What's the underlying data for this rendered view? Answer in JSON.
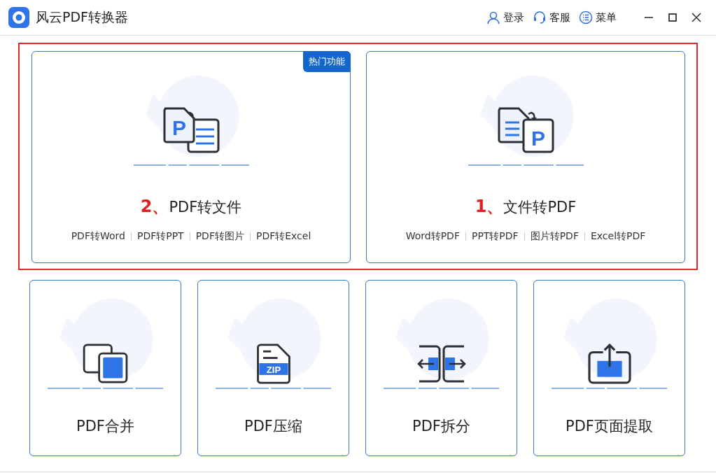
{
  "window": {
    "title": "风云PDF转换器"
  },
  "header_actions": [
    {
      "kind": "user",
      "label": "登录"
    },
    {
      "kind": "headset",
      "label": "客服"
    },
    {
      "kind": "menu",
      "label": "菜单"
    }
  ],
  "features": [
    {
      "kind": "pdf-to-file",
      "number": "2、",
      "title": "PDF转文件",
      "badge": "热门功能",
      "icon_letter": "P",
      "links": [
        "PDF转Word",
        "PDF转PPT",
        "PDF转图片",
        "PDF转Excel"
      ]
    },
    {
      "kind": "file-to-pdf",
      "number": "1、",
      "title": "文件转PDF",
      "icon_letter": "P",
      "links": [
        "Word转PDF",
        "PPT转PDF",
        "图片转PDF",
        "Excel转PDF"
      ]
    }
  ],
  "tools": [
    {
      "kind": "merge",
      "title": "PDF合并"
    },
    {
      "kind": "zip",
      "title": "PDF压缩",
      "icon_label": "ZIP"
    },
    {
      "kind": "split",
      "title": "PDF拆分"
    },
    {
      "kind": "extract",
      "title": "PDF页面提取"
    }
  ]
}
